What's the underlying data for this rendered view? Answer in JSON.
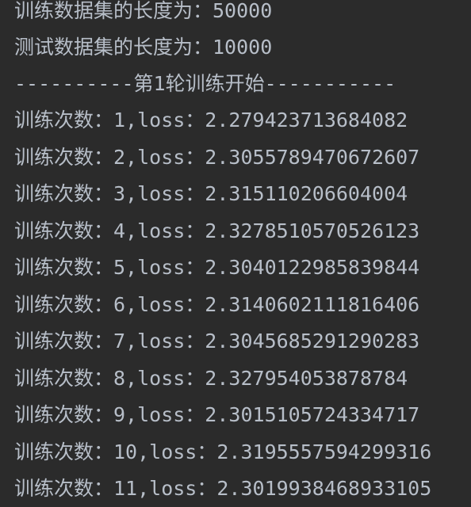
{
  "console": {
    "text_color": "#b7bec8",
    "background": "#2b2b2b",
    "lines": [
      "训练数据集的长度为：50000",
      "测试数据集的长度为：10000",
      "----------第1轮训练开始-----------",
      "训练次数：1,loss：2.279423713684082",
      "训练次数：2,loss：2.3055789470672607",
      "训练次数：3,loss：2.315110206604004",
      "训练次数：4,loss：2.3278510570526123",
      "训练次数：5,loss：2.3040122985839844",
      "训练次数：6,loss：2.3140602111816406",
      "训练次数：7,loss：2.3045685291290283",
      "训练次数：8,loss：2.327954053878784",
      "训练次数：9,loss：2.3015105724334717",
      "训练次数：10,loss：2.3195557594299316",
      "训练次数：11,loss：2.3019938468933105"
    ]
  }
}
